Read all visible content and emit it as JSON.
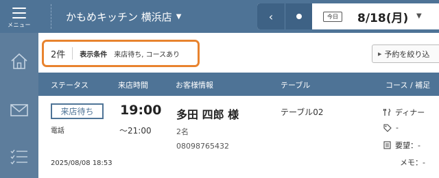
{
  "topbar": {
    "menu_label": "メニュー",
    "store_name": "かもめキッチン 横浜店",
    "store_caret": "▼",
    "prev_symbol": "‹",
    "today_badge": "今日",
    "date": "8/18(月)",
    "date_caret": "▼"
  },
  "sidebar": {
    "items": [
      {
        "icon": "home-icon"
      },
      {
        "icon": "mail-icon"
      },
      {
        "icon": "task-list-icon"
      }
    ]
  },
  "filter": {
    "count": "2件",
    "title": "表示条件",
    "value": "来店待ち, コースあり",
    "narrow_button": "予約を絞り込"
  },
  "table": {
    "headers": {
      "status": "ステータス",
      "time": "来店時間",
      "customer": "お客様情報",
      "table": "テーブル",
      "course": "コース / 補足"
    },
    "rows": [
      {
        "status": "来店待ち",
        "source": "電話",
        "created_at": "2025/08/08 18:53",
        "start_time": "19:00",
        "end_time": "～21:00",
        "customer_name": "多田 四郎 様",
        "party_size": "2名",
        "phone": "08098765432",
        "table_name": "テーブル02",
        "course": "ディナー",
        "tag": "-",
        "request": "要望：-",
        "memo": "メモ：-"
      }
    ]
  },
  "colors": {
    "header_blue": "#4e7396",
    "sidebar_blue": "#5d7d9c",
    "highlight_orange": "#e8832e"
  }
}
